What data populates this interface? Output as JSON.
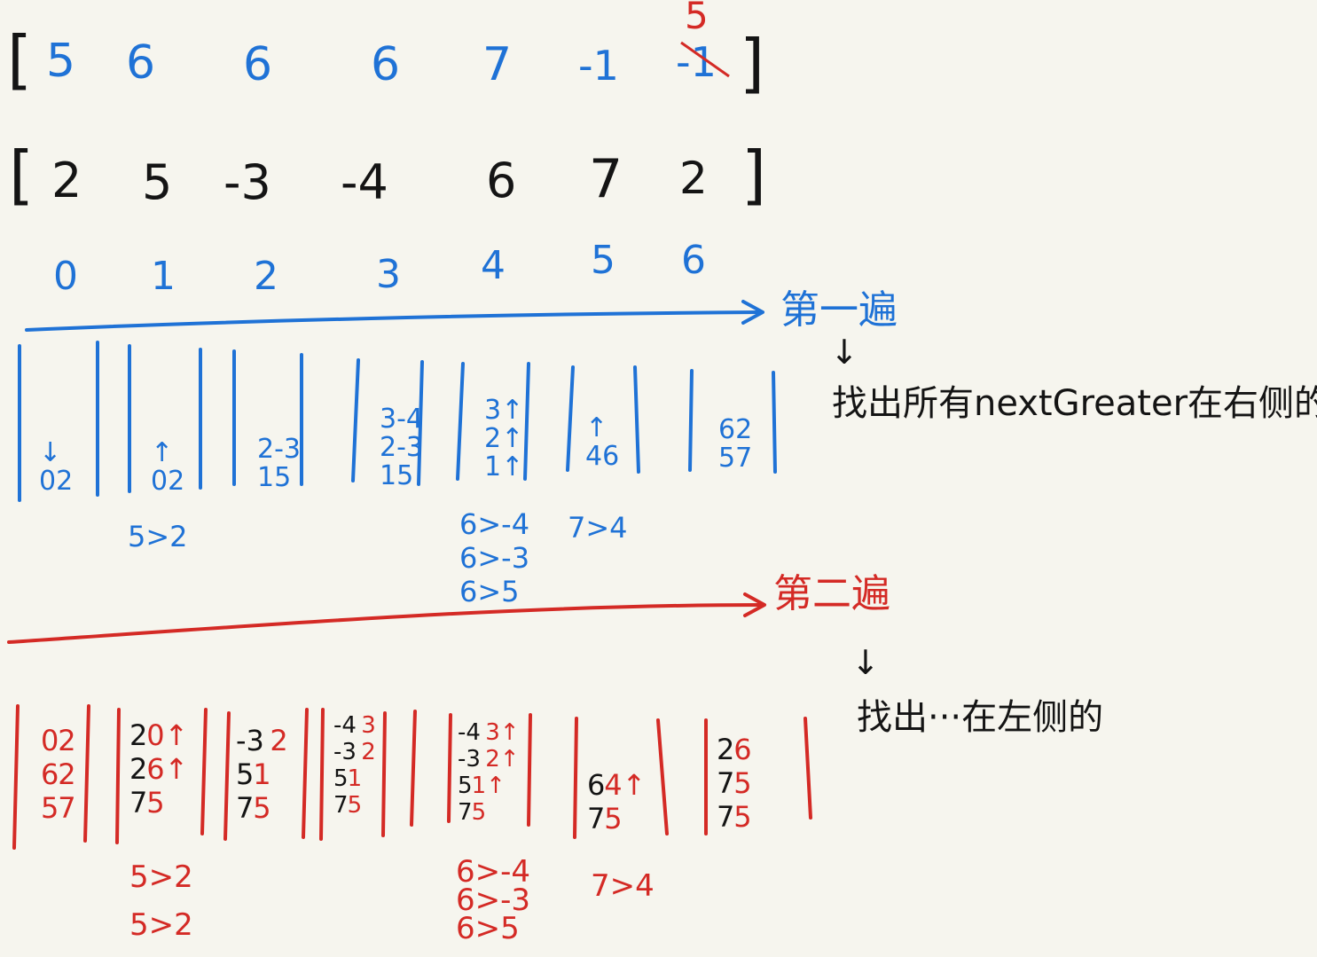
{
  "colors": {
    "blue": "#1f72d6",
    "black": "#141414",
    "red": "#d42a25",
    "background": "#f6f5ee"
  },
  "result_row": {
    "open": "[",
    "close": "]",
    "values": [
      "5",
      "6",
      "6",
      "6",
      "7",
      "-1",
      "-1"
    ],
    "correction": "5"
  },
  "input_row": {
    "open": "[",
    "close": "]",
    "values": [
      "2",
      "5",
      "-3",
      "-4",
      "6",
      "7",
      "2"
    ]
  },
  "index_row": [
    "0",
    "1",
    "2",
    "3",
    "4",
    "5",
    "6"
  ],
  "pass_one": {
    "label": "第一遍",
    "arrow_down": "↓",
    "note": "找出所有nextGreater在右侧的",
    "stacks": [
      {
        "lines": [
          {
            "text": "↓"
          },
          {
            "text": "02"
          }
        ]
      },
      {
        "lines": [
          {
            "text": "↑"
          },
          {
            "text": "02"
          }
        ]
      },
      {
        "lines": [
          {
            "text": "2-3"
          },
          {
            "text": "15"
          }
        ]
      },
      {
        "lines": [
          {
            "text": "3-4"
          },
          {
            "text": "2-3"
          },
          {
            "text": "15"
          }
        ]
      },
      {
        "lines": [
          {
            "text": "3↑"
          },
          {
            "text": "2↑"
          },
          {
            "text": "1↑"
          }
        ]
      },
      {
        "lines": [
          {
            "text": "↑"
          },
          {
            "text": "46"
          }
        ]
      },
      {
        "lines": [
          {
            "text": "62"
          },
          {
            "text": "57"
          }
        ]
      }
    ],
    "comparisons": [
      {
        "column": 1,
        "lines": [
          "5>2"
        ]
      },
      {
        "column": 4,
        "lines": [
          "6>-4",
          "6>-3",
          "6>5"
        ]
      },
      {
        "column": 5,
        "lines": [
          "7>4"
        ]
      }
    ]
  },
  "pass_two": {
    "label": "第二遍",
    "arrow_down": "↓",
    "note": "找出···在左侧的",
    "stacks": [
      {
        "lines": [
          [
            "0",
            "red"
          ],
          [
            "2",
            "red"
          ],
          [
            "|",
            "gap"
          ],
          [
            "6",
            "red"
          ],
          [
            "2",
            "red"
          ],
          [
            "|",
            "gap"
          ],
          [
            "5",
            "red"
          ],
          [
            "7",
            "red"
          ]
        ]
      },
      {
        "lines": [
          [
            "2",
            "black"
          ],
          [
            " 0↑",
            "red"
          ],
          [
            "|",
            "gap"
          ],
          [
            "2",
            "black"
          ],
          [
            " 6↑",
            "red"
          ],
          [
            "|",
            "gap"
          ],
          [
            "7",
            "black"
          ],
          [
            "5",
            "red"
          ]
        ]
      },
      {
        "lines": [
          [
            "-3",
            "black"
          ],
          [
            "2",
            "red"
          ],
          [
            "|",
            "gap"
          ],
          [
            "5",
            "black"
          ],
          [
            "1",
            "red"
          ],
          [
            "|",
            "gap"
          ],
          [
            "7",
            "black"
          ],
          [
            "5",
            "red"
          ]
        ]
      },
      {
        "lines": [
          [
            "-4",
            "black"
          ],
          [
            "3",
            "red"
          ],
          [
            "|",
            "gap"
          ],
          [
            "-3",
            "black"
          ],
          [
            "2",
            "red"
          ],
          [
            "|",
            "gap"
          ],
          [
            "5",
            "black"
          ],
          [
            "1",
            "red"
          ],
          [
            "|",
            "gap"
          ],
          [
            "7",
            "black"
          ],
          [
            "5",
            "red"
          ]
        ]
      },
      {
        "lines": [
          [
            "-4",
            "black"
          ],
          [
            "3↑",
            "red"
          ],
          [
            "|",
            "gap"
          ],
          [
            "-3",
            "black"
          ],
          [
            "2↑",
            "red"
          ],
          [
            "|",
            "gap"
          ],
          [
            "5",
            "black"
          ],
          [
            "1↑",
            "red"
          ],
          [
            "|",
            "gap"
          ],
          [
            "7",
            "black"
          ],
          [
            "5",
            "red"
          ]
        ]
      },
      {
        "lines": [
          [
            "6",
            "black"
          ],
          [
            "4↑",
            "red"
          ],
          [
            "|",
            "gap"
          ],
          [
            "7",
            "black"
          ],
          [
            "5",
            "red"
          ]
        ]
      },
      {
        "lines": [
          [
            "2",
            "black"
          ],
          [
            "6",
            "red"
          ],
          [
            "|",
            "gap"
          ],
          [
            "7",
            "black"
          ],
          [
            "5",
            "red"
          ],
          [
            "|",
            "gap"
          ],
          [
            "7",
            "black"
          ],
          [
            "5",
            "red"
          ]
        ]
      }
    ],
    "comparisons": [
      {
        "column": 1,
        "lines": [
          "5>2",
          "5>2"
        ]
      },
      {
        "column": 4,
        "lines": [
          "6>-4",
          "6>-3",
          "6>5"
        ]
      },
      {
        "column": 5,
        "lines": [
          "7>4"
        ]
      }
    ]
  }
}
